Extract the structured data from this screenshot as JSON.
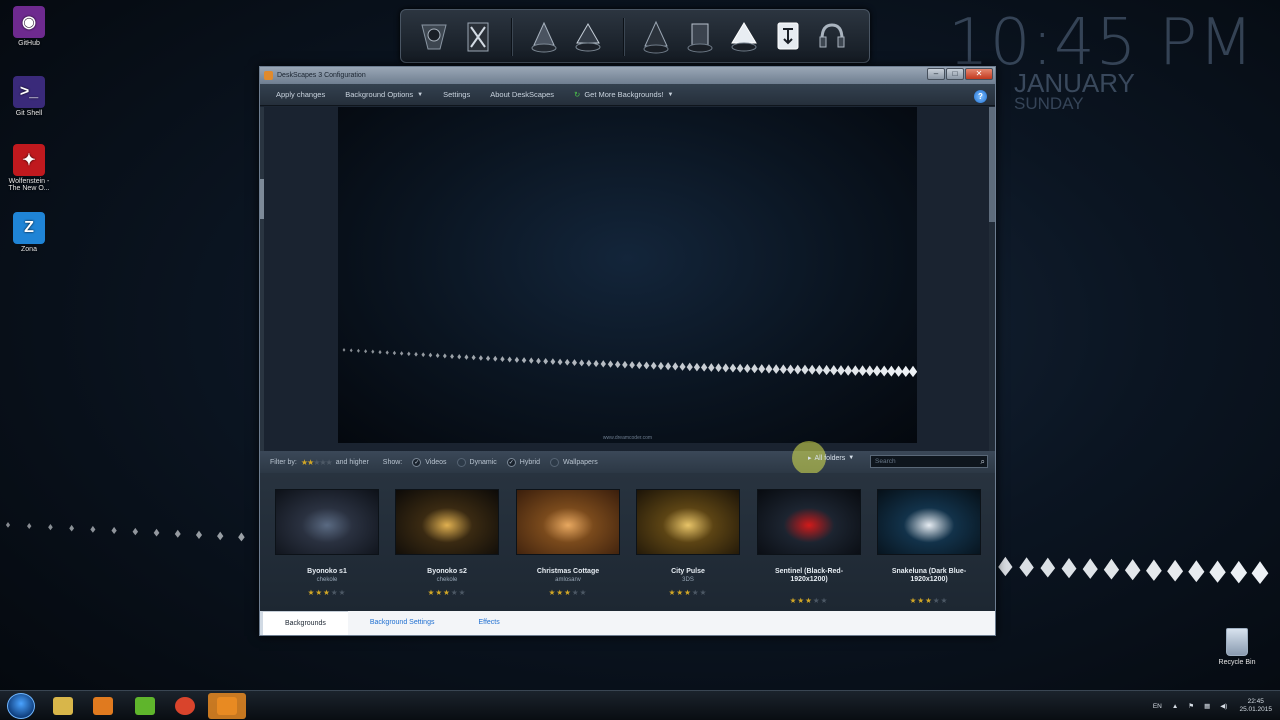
{
  "desktop": {
    "icons": [
      {
        "label": "GitHub",
        "color": "#6e2a8f",
        "glyph": "◉"
      },
      {
        "label": "Git Shell",
        "color": "#3a2a7a",
        "glyph": ">_"
      },
      {
        "label": "Wolfenstein - The New O...",
        "color": "#c0191e",
        "glyph": "✦"
      },
      {
        "label": "Zona",
        "color": "#1f84d6",
        "glyph": "Z"
      }
    ],
    "recycle_bin_label": "Recycle Bin"
  },
  "dock": {
    "items": [
      "dock-app-1",
      "dock-app-2",
      "dock-app-3",
      "dock-app-4",
      "dock-app-5",
      "dock-app-6",
      "dock-app-7",
      "dock-app-8",
      "dock-app-9"
    ]
  },
  "clock": {
    "time": "10:45 PM",
    "month": "JANUARY",
    "day": "SUNDAY"
  },
  "window": {
    "title": "DeskScapes 3 Configuration",
    "menu": {
      "apply": "Apply changes",
      "background_options": "Background Options",
      "settings": "Settings",
      "about": "About DeskScapes",
      "get_more": "Get More Backgrounds!"
    },
    "preview_credit": "www.dreamcoder.com",
    "filter": {
      "filter_by": "Filter by:",
      "rating": 2,
      "and_higher": "and higher",
      "show": "Show:",
      "videos": "Videos",
      "dynamic": "Dynamic",
      "hybrid": "Hybrid",
      "wallpapers": "Wallpapers",
      "all_folders": "All folders",
      "search_placeholder": "Search"
    },
    "backgrounds": [
      {
        "name": "Byonoko s1",
        "author": "chekole",
        "rating": 3,
        "colors": [
          "#2a3140",
          "#0d1118",
          "#5a6a82"
        ]
      },
      {
        "name": "Byonoko s2",
        "author": "chekole",
        "rating": 3,
        "colors": [
          "#3a2a12",
          "#0c0a08",
          "#e0b050"
        ]
      },
      {
        "name": "Christmas Cottage",
        "author": "amlosanv",
        "rating": 3,
        "colors": [
          "#7a4a1c",
          "#3a1e0c",
          "#e8a860"
        ]
      },
      {
        "name": "City Pulse",
        "author": "3DS",
        "rating": 3,
        "colors": [
          "#5c4414",
          "#1c1408",
          "#e8c468"
        ]
      },
      {
        "name": "Sentinel (Black-Red-1920x1200)",
        "author": "",
        "rating": 3,
        "colors": [
          "#1c2430",
          "#080b10",
          "#d11a1a"
        ]
      },
      {
        "name": "Snakeluna (Dark Blue-1920x1200)",
        "author": "",
        "rating": 3,
        "colors": [
          "#12324a",
          "#061018",
          "#e6ecf2"
        ]
      }
    ],
    "tabs": [
      "Backgrounds",
      "Background Settings",
      "Effects"
    ]
  },
  "taskbar": {
    "apps": [
      {
        "name": "explorer",
        "color": "#d8b64a"
      },
      {
        "name": "media-player",
        "color": "#e07a1f"
      },
      {
        "name": "utorrent",
        "color": "#5fb52c"
      },
      {
        "name": "chrome",
        "color": "#d9442c"
      },
      {
        "name": "deskscapes",
        "color": "#e88a22"
      }
    ],
    "lang": "EN",
    "time": "22:45",
    "date": "25.01.2015"
  }
}
